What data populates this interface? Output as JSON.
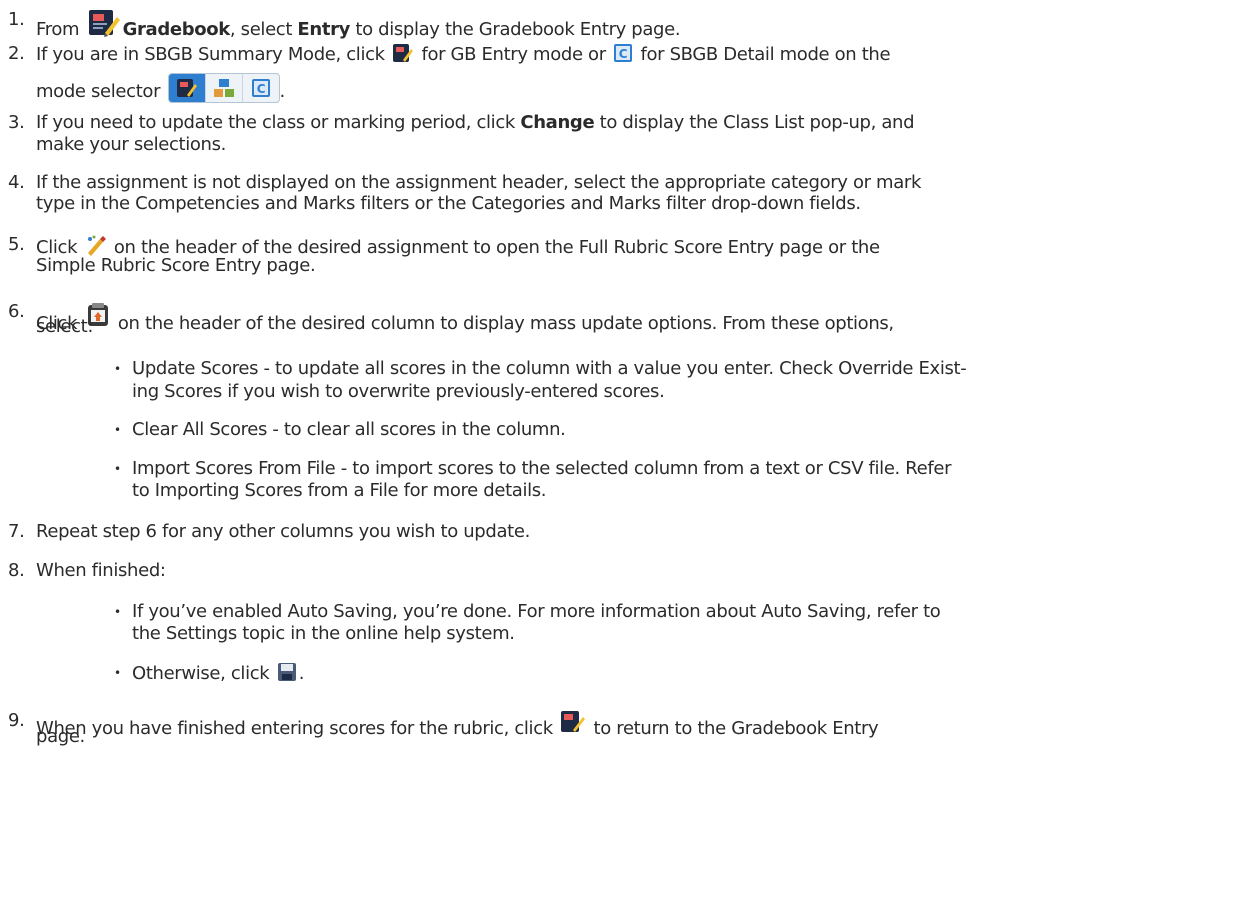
{
  "steps": [
    {
      "num": "1.",
      "a": "From ",
      "b": "Gradebook",
      "c": ", select ",
      "d": "Entry",
      "e": " to display the Gradebook Entry page."
    },
    {
      "num": "2.",
      "a": "If you are in SBGB Summary Mode, click ",
      "b": " for GB Entry mode or ",
      "c": " for SBGB Detail mode on the",
      "d": "mode selector",
      "e": "."
    },
    {
      "num": "3.",
      "a": "If you need to update the class or marking period, click ",
      "b": "Change",
      "c": " to display the Class List pop-up, and",
      "d": "make your selections."
    },
    {
      "num": "4.",
      "a": "If the assignment is not displayed on the assignment header, select the appropriate category or mark",
      "b": "type in the Competencies and Marks filters or the Categories and Marks filter drop-down fields."
    },
    {
      "num": "5.",
      "a": "Click ",
      "b": " on the header of the desired assignment to open the Full Rubric Score Entry page or the",
      "c": "Simple Rubric Score Entry page."
    },
    {
      "num": "6.",
      "a": "Click ",
      "b": " on the header of the desired column to display mass update options. From these options,",
      "c": "select:"
    },
    {
      "num": "7.",
      "a": "Repeat step 6 for any other columns you wish to update."
    },
    {
      "num": "8.",
      "a": "When finished:"
    },
    {
      "num": "9.",
      "a": "When you have finished entering scores for the rubric, click ",
      "b": " to return to the Gradebook Entry",
      "c": "page."
    }
  ],
  "step6_bullets": [
    {
      "l1": "Update Scores - to update all scores in the column with a value you enter. Check Override Exist-",
      "l2": "ing Scores if you wish to overwrite previously-entered scores."
    },
    {
      "l1": "Clear All Scores - to clear all scores in the column."
    },
    {
      "l1": "Import Scores From File - to import scores to the selected column from a text or CSV file. Refer",
      "l2": "to Importing Scores from a File for more details."
    }
  ],
  "step8_bullets": [
    {
      "l1": "If you’ve enabled Auto Saving, you’re done. For more information about Auto Saving, refer to",
      "l2": "the Settings topic in the online help system."
    },
    {
      "a": "Otherwise, click ",
      "b": "."
    }
  ],
  "bullet_glyph": "•",
  "icons": [
    "gradebook-icon",
    "gb-entry-mode-icon",
    "sbgb-detail-mode-icon",
    "mode-selector",
    "rubric-pencil-icon",
    "mass-update-icon",
    "save-icon",
    "return-gradebook-icon"
  ]
}
